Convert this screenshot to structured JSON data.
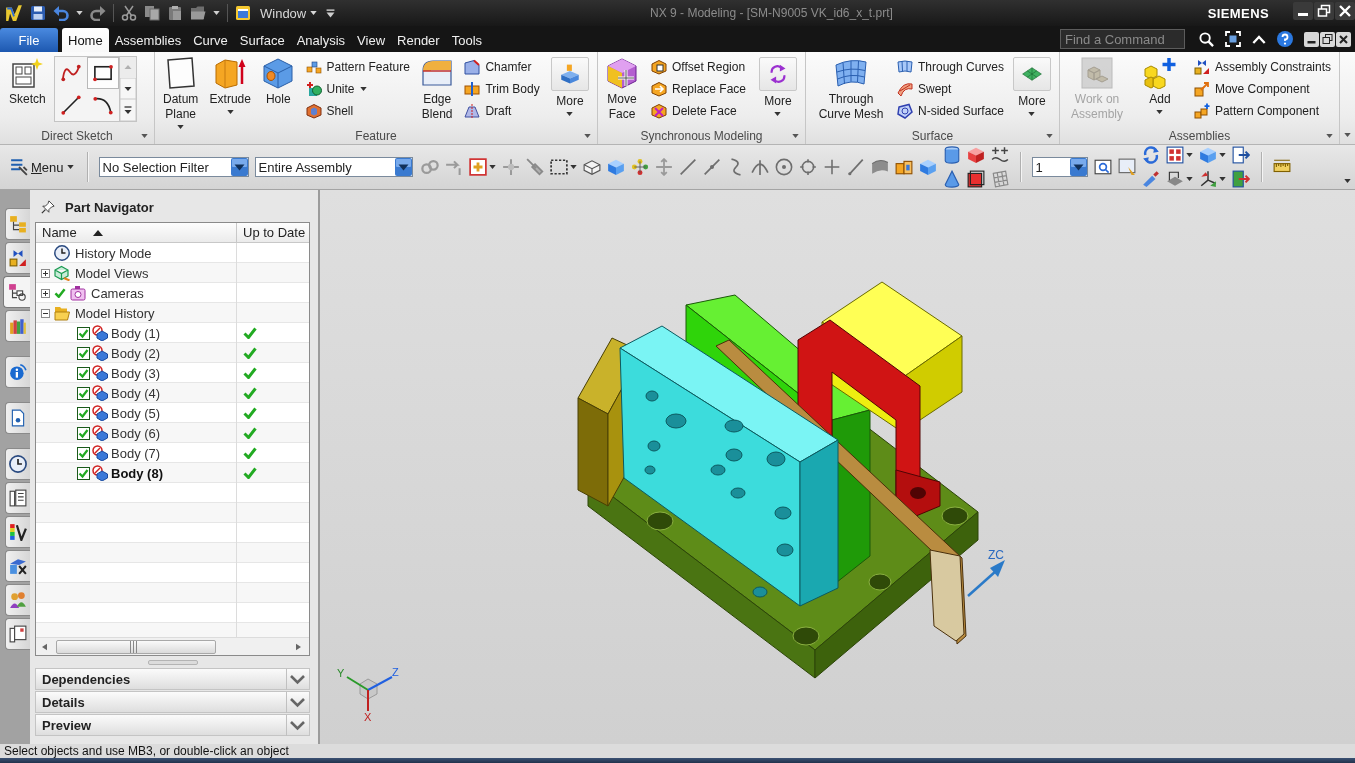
{
  "window": {
    "menu_label": "Window",
    "title": "NX 9 - Modeling - [SM-N9005 VK_id6_x_t.prt]",
    "brand": "SIEMENS"
  },
  "ribbon_tabs": [
    {
      "label": "File",
      "kind": "file",
      "selected": false
    },
    {
      "label": "Home",
      "kind": "tab",
      "selected": true
    },
    {
      "label": "Assemblies",
      "kind": "tab",
      "selected": false
    },
    {
      "label": "Curve",
      "kind": "tab",
      "selected": false
    },
    {
      "label": "Surface",
      "kind": "tab",
      "selected": false
    },
    {
      "label": "Analysis",
      "kind": "tab",
      "selected": false
    },
    {
      "label": "View",
      "kind": "tab",
      "selected": false
    },
    {
      "label": "Render",
      "kind": "tab",
      "selected": false
    },
    {
      "label": "Tools",
      "kind": "tab",
      "selected": false
    }
  ],
  "command_search": {
    "placeholder": "Find a Command"
  },
  "ribbon_groups": [
    {
      "title": "Direct Sketch",
      "gallery": true,
      "buttons": [
        {
          "kind": "large",
          "label": "Sketch",
          "dropdown": false,
          "disabled": false
        }
      ]
    },
    {
      "title": "Feature",
      "buttons": [
        {
          "kind": "large",
          "label": "Datum Plane",
          "dropdown": true,
          "disabled": false
        },
        {
          "kind": "large",
          "label": "Extrude",
          "dropdown": true,
          "disabled": false
        },
        {
          "kind": "large",
          "label": "Hole",
          "dropdown": false,
          "disabled": false
        },
        {
          "kind": "small",
          "label": "Pattern Feature",
          "dropdown": false,
          "disabled": false
        },
        {
          "kind": "small",
          "label": "Unite",
          "dropdown": true,
          "disabled": false
        },
        {
          "kind": "small",
          "label": "Shell",
          "dropdown": false,
          "disabled": false
        },
        {
          "kind": "large",
          "label": "Edge Blend",
          "dropdown": false,
          "disabled": false
        },
        {
          "kind": "small",
          "label": "Chamfer",
          "dropdown": false,
          "disabled": false
        },
        {
          "kind": "small",
          "label": "Trim Body",
          "dropdown": false,
          "disabled": false
        },
        {
          "kind": "small",
          "label": "Draft",
          "dropdown": false,
          "disabled": false
        },
        {
          "kind": "more",
          "label": "More",
          "dropdown": true,
          "disabled": false
        }
      ]
    },
    {
      "title": "Synchronous Modeling",
      "buttons": [
        {
          "kind": "large",
          "label": "Move Face",
          "dropdown": false,
          "disabled": false
        },
        {
          "kind": "small",
          "label": "Offset Region",
          "dropdown": false,
          "disabled": false
        },
        {
          "kind": "small",
          "label": "Replace Face",
          "dropdown": false,
          "disabled": false
        },
        {
          "kind": "small",
          "label": "Delete Face",
          "dropdown": false,
          "disabled": false
        },
        {
          "kind": "more",
          "label": "More",
          "dropdown": true,
          "disabled": false
        }
      ]
    },
    {
      "title": "Surface",
      "buttons": [
        {
          "kind": "large",
          "label": "Through Curve Mesh",
          "dropdown": false,
          "disabled": false
        },
        {
          "kind": "small",
          "label": "Through Curves",
          "dropdown": false,
          "disabled": false
        },
        {
          "kind": "small",
          "label": "Swept",
          "dropdown": false,
          "disabled": false
        },
        {
          "kind": "small",
          "label": "N-sided Surface",
          "dropdown": false,
          "disabled": false
        },
        {
          "kind": "more",
          "label": "More",
          "dropdown": true,
          "disabled": false
        }
      ]
    },
    {
      "title": "Assemblies",
      "buttons": [
        {
          "kind": "large",
          "label": "Work on Assembly",
          "dropdown": false,
          "disabled": true
        },
        {
          "kind": "large",
          "label": "Add",
          "dropdown": true,
          "disabled": false
        },
        {
          "kind": "small",
          "label": "Assembly Constraints",
          "dropdown": false,
          "disabled": false
        },
        {
          "kind": "small",
          "label": "Move Component",
          "dropdown": false,
          "disabled": false
        },
        {
          "kind": "small",
          "label": "Pattern Component",
          "dropdown": false,
          "disabled": false
        }
      ]
    }
  ],
  "toolbar": {
    "menu_label": "Menu",
    "selection_filter": "No Selection Filter",
    "assembly_scope": "Entire Assembly",
    "layer": "1"
  },
  "resource_tabs": [
    {
      "selected": false
    },
    {
      "selected": false
    },
    {
      "selected": true
    },
    {
      "selected": false
    },
    {
      "selected": false
    },
    {
      "selected": false
    },
    {
      "selected": false
    },
    {
      "selected": false
    },
    {
      "selected": false
    },
    {
      "selected": false
    },
    {
      "selected": false
    },
    {
      "selected": false
    }
  ],
  "part_navigator": {
    "title": "Part Navigator",
    "columns": [
      "Name",
      "Up to Date"
    ],
    "nodes": [
      {
        "kind": "history",
        "label": "History Mode"
      },
      {
        "kind": "views",
        "label": "Model Views",
        "expanded": false
      },
      {
        "kind": "cameras",
        "label": "Cameras",
        "expanded": false,
        "checked": true
      },
      {
        "kind": "folder",
        "label": "Model History",
        "expanded": true,
        "children": [
          {
            "kind": "body",
            "label": "Body (1)",
            "checked": true,
            "up_to_date": true,
            "current": false
          },
          {
            "kind": "body",
            "label": "Body (2)",
            "checked": true,
            "up_to_date": true,
            "current": false
          },
          {
            "kind": "body",
            "label": "Body (3)",
            "checked": true,
            "up_to_date": true,
            "current": false
          },
          {
            "kind": "body",
            "label": "Body (4)",
            "checked": true,
            "up_to_date": true,
            "current": false
          },
          {
            "kind": "body",
            "label": "Body (5)",
            "checked": true,
            "up_to_date": true,
            "current": false
          },
          {
            "kind": "body",
            "label": "Body (6)",
            "checked": true,
            "up_to_date": true,
            "current": false
          },
          {
            "kind": "body",
            "label": "Body (7)",
            "checked": true,
            "up_to_date": true,
            "current": false
          },
          {
            "kind": "body",
            "label": "Body (8)",
            "checked": true,
            "up_to_date": true,
            "current": true
          }
        ]
      }
    ],
    "panels": [
      {
        "title": "Dependencies",
        "expanded": false
      },
      {
        "title": "Details",
        "expanded": false
      },
      {
        "title": "Preview",
        "expanded": false
      }
    ]
  },
  "graphics_window": {
    "axis_label": "ZC",
    "triad_labels": [
      "Y",
      "Z",
      "X"
    ]
  },
  "status_bar": {
    "text": "Select objects and use MB3, or double-click an object"
  }
}
